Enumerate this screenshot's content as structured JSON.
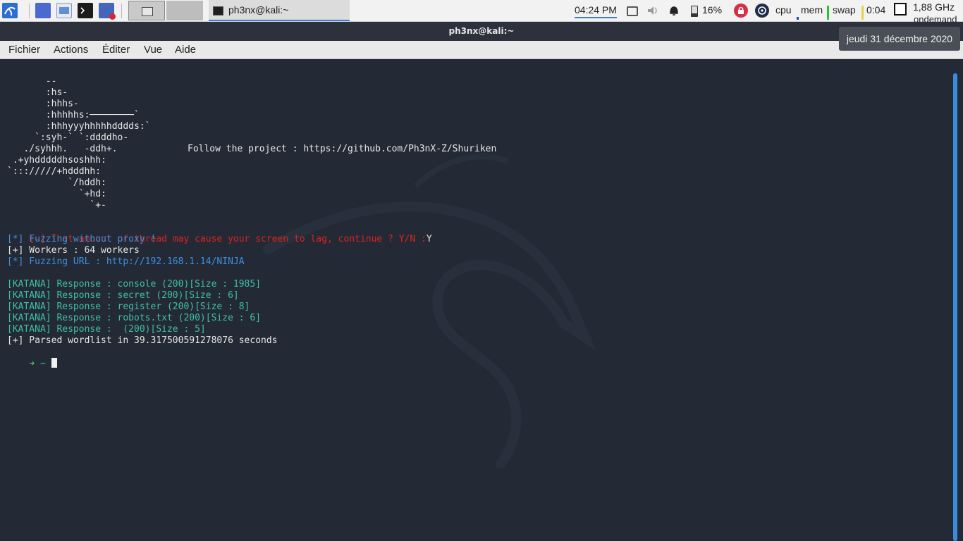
{
  "panel": {
    "task_label": "ph3nx@kali:~",
    "clock": "04:24 PM",
    "battery": "16%",
    "cpu_label": "cpu",
    "mem_label": "mem",
    "swap_label": "swap",
    "uptime": "0:04",
    "cpu_freq": "1,88 GHz",
    "governor": "ondemand"
  },
  "tooltip": {
    "date": "jeudi 31 décembre 2020"
  },
  "window": {
    "title": "ph3nx@kali:~"
  },
  "menu": {
    "fichier": "Fichier",
    "actions": "Actions",
    "editer": "Éditer",
    "vue": "Vue",
    "aide": "Aide"
  },
  "terminal": {
    "logo": [
      "       --",
      "       :hs-",
      "       :hhhs-",
      "       :hhhhhs:────────`",
      "       :hhhyyyhhhhhdddds:`",
      "     `:syh-` `:ddddho-",
      "   ./syhhh.   -ddh+.",
      " .+yhdddddhsoshhh:",
      "`::://///+hdddhh:",
      "           `/hddh:",
      "             `+hd:",
      "               `+-"
    ],
    "follow": "Follow the project : https://github.com/Ph3nX-Z/Shuriken",
    "warning": "[-] That amount of thread may cause your screen to lag, continue ? Y/N :",
    "answer": "Y",
    "proxy": "[*] Fuzzing without proxy !",
    "workers": "[+] Workers : 64 workers",
    "url": "[*] Fuzzing URL : http://192.168.1.14/NINJA",
    "responses": [
      "[KATANA] Response : console (200)[Size : 1985]",
      "[KATANA] Response : secret (200)[Size : 6]",
      "[KATANA] Response : register (200)[Size : 8]",
      "[KATANA] Response : robots.txt (200)[Size : 6]",
      "[KATANA] Response :  (200)[Size : 5]"
    ],
    "parsed": "[+] Parsed wordlist in 39.317500591278076 seconds",
    "prompt_arrow": "➜",
    "prompt_dir": "~"
  }
}
